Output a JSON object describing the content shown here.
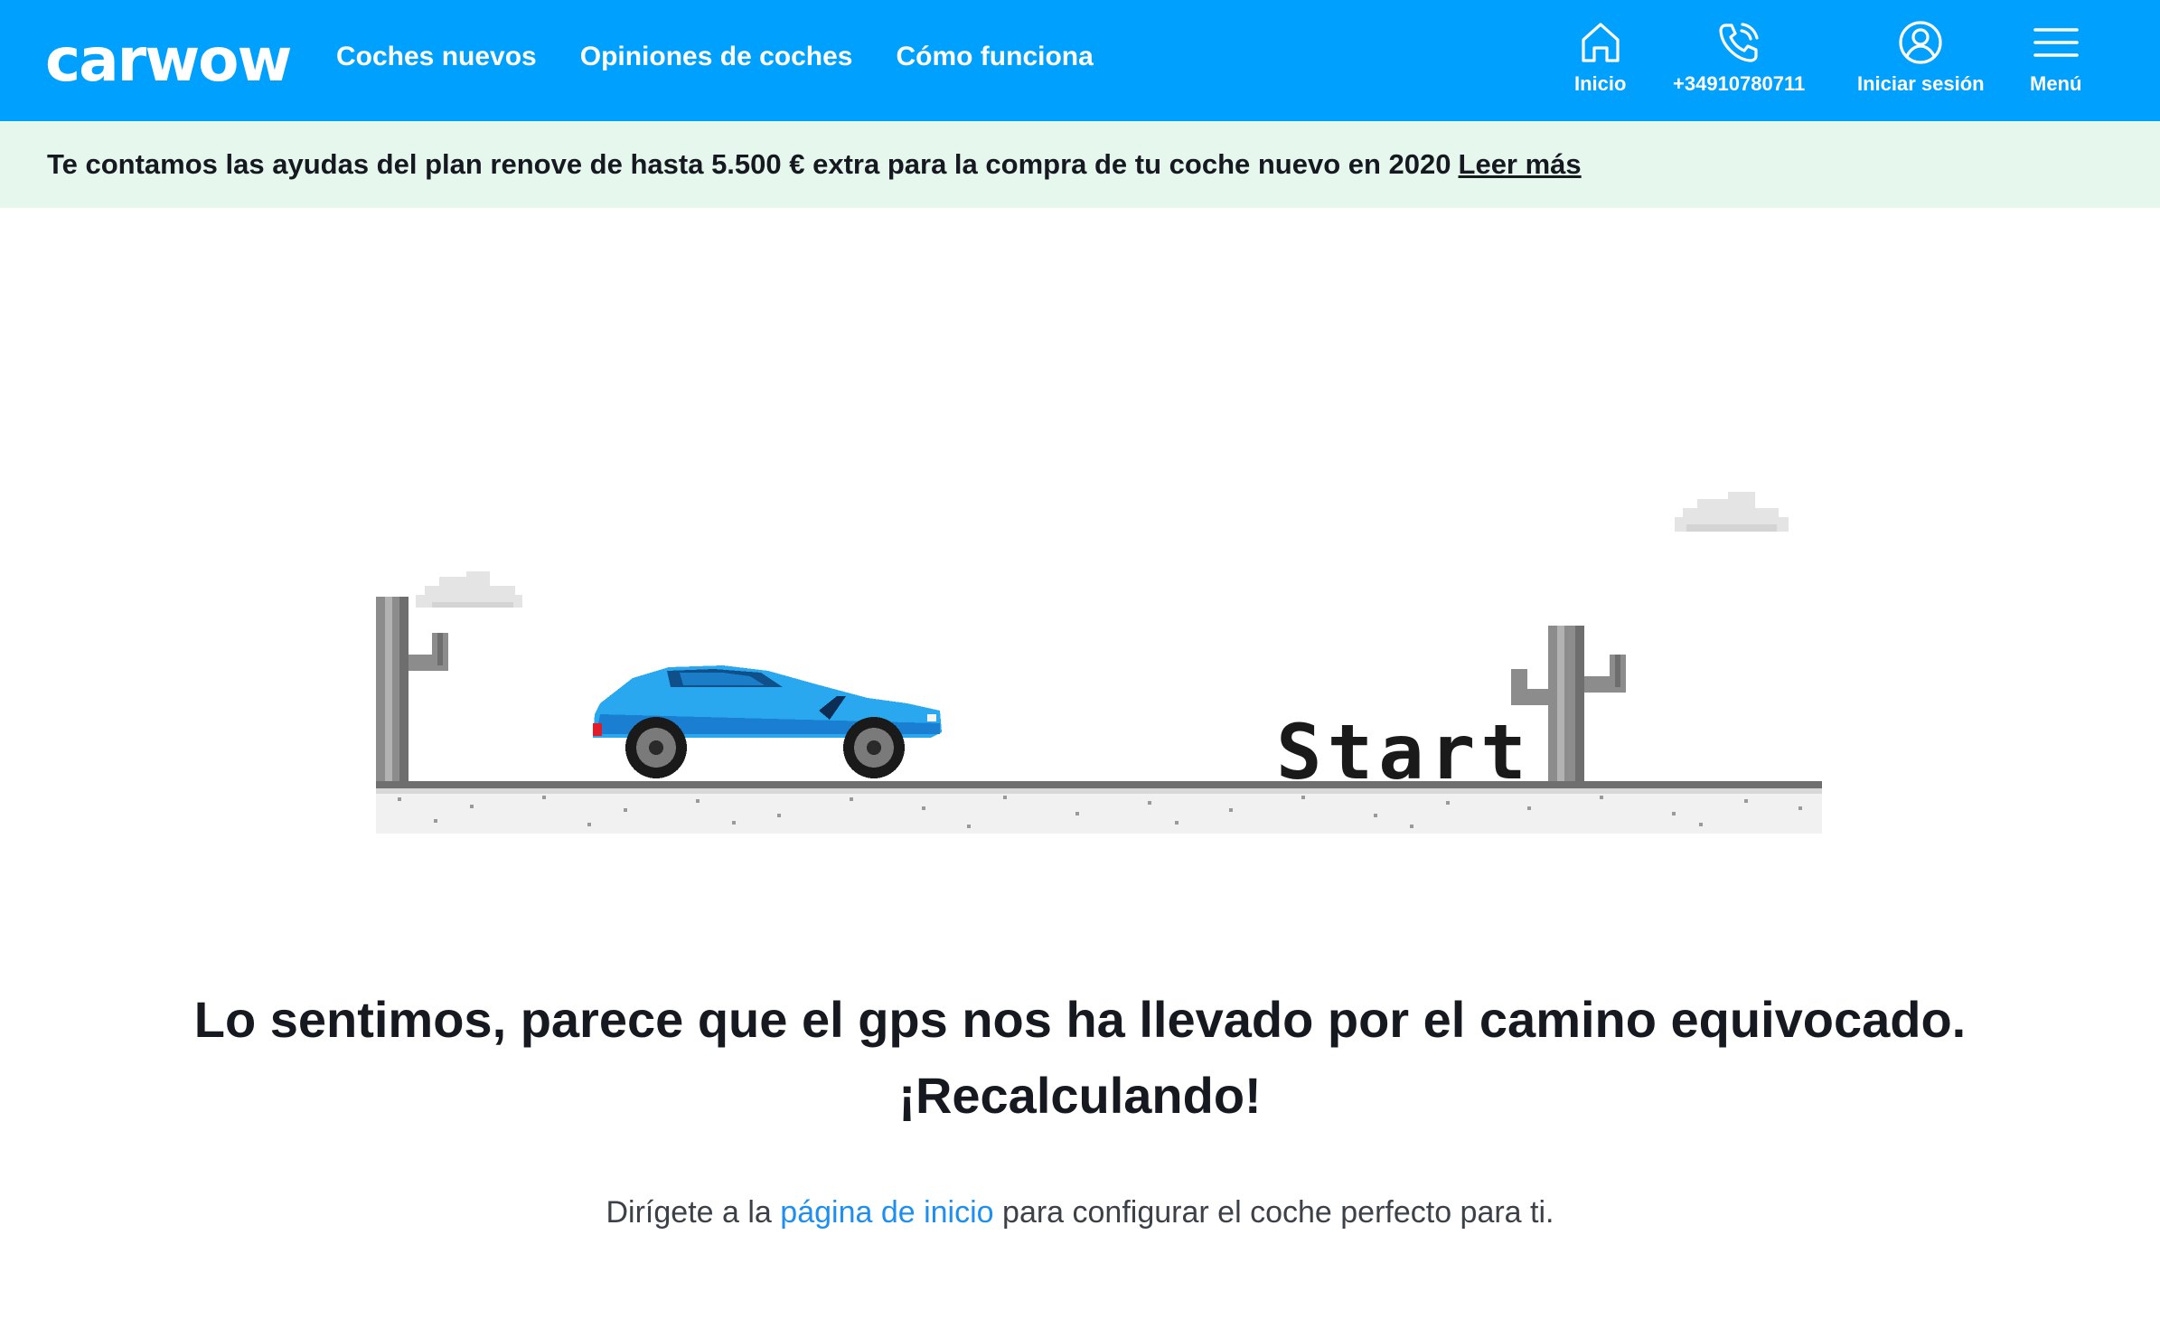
{
  "header": {
    "logo": "carwow",
    "nav": [
      "Coches nuevos",
      "Opiniones de coches",
      "Cómo funciona"
    ],
    "icons": {
      "home": {
        "label": "Inicio",
        "icon": "home-icon"
      },
      "phone": {
        "label": "+34910780711",
        "icon": "phone-icon"
      },
      "login": {
        "label": "Iniciar sesión",
        "icon": "user-icon"
      },
      "menu": {
        "label": "Menú",
        "icon": "hamburger-icon"
      }
    },
    "bg_color": "#00a0ff"
  },
  "promo": {
    "text": "Te contamos las ayudas del plan renove de hasta 5.500 € extra para la compra de tu coche nuevo en 2020",
    "link": "Leer más",
    "bg_color": "#e6f8ee"
  },
  "scene": {
    "start_label": "Start",
    "car_color": "#29a8f0"
  },
  "message": {
    "line1": "Lo sentimos, parece que el gps nos ha llevado por el camino equivocado.",
    "line2": "¡Recalculando!",
    "sub_before": "Dirígete a la",
    "sub_link": "página de inicio",
    "sub_after": "para configurar el coche perfecto para ti.",
    "link_color": "#1e8ff0"
  }
}
